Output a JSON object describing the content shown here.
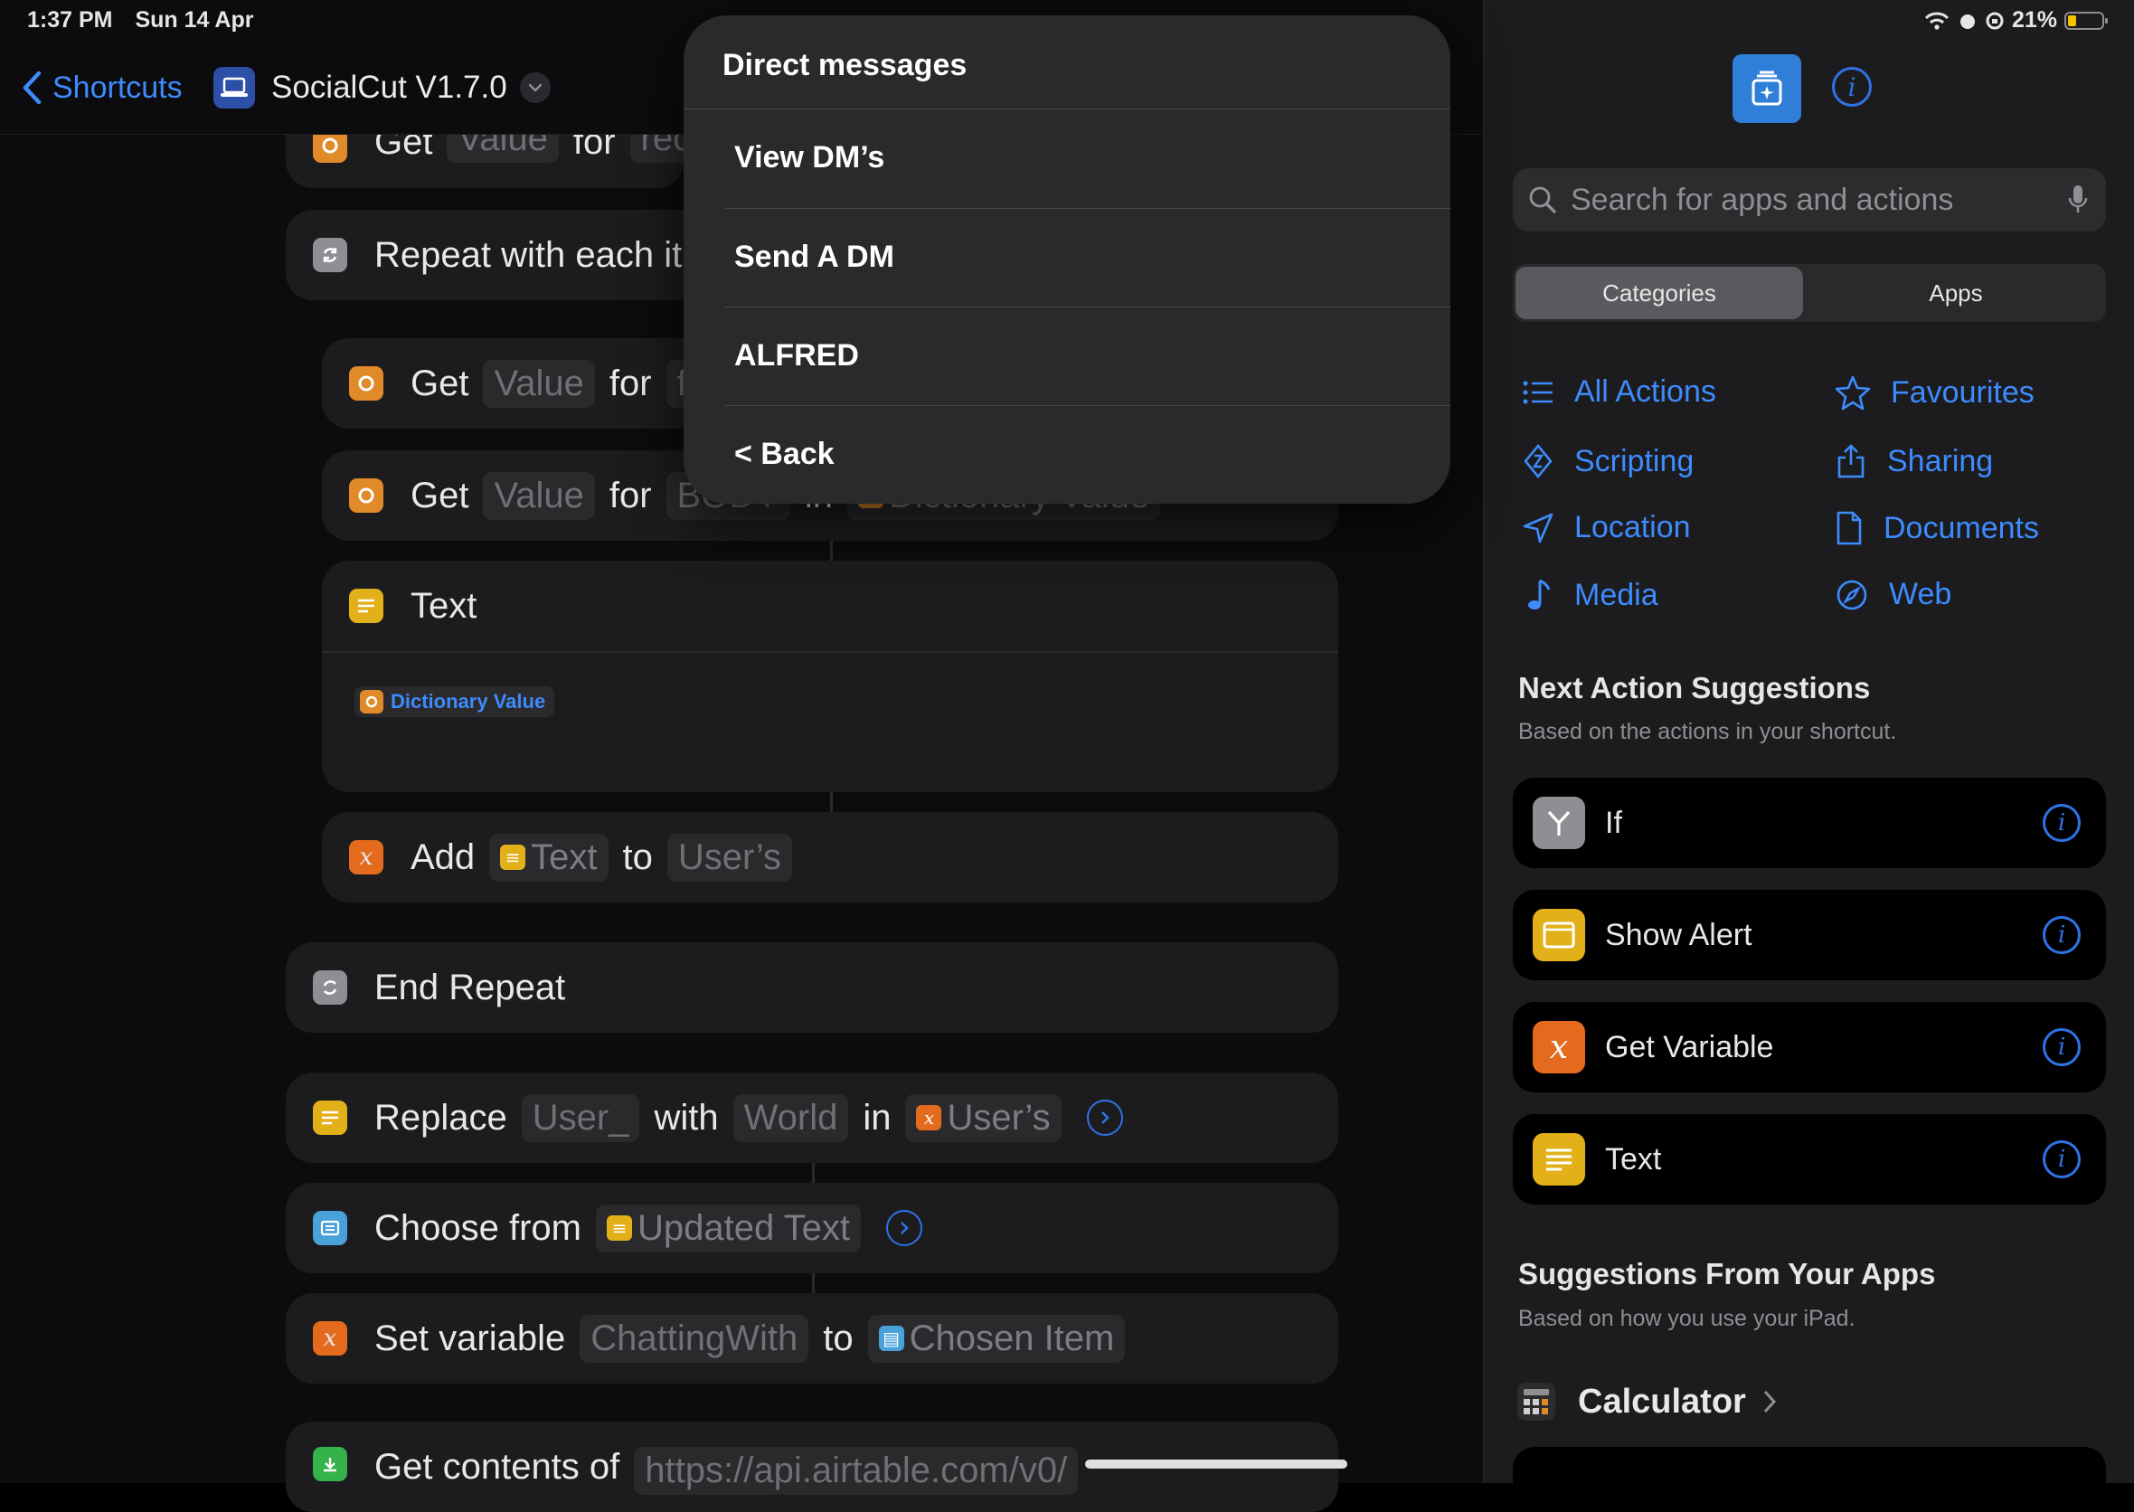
{
  "status_bar": {
    "time": "1:37 PM",
    "date": "Sun 14 Apr",
    "battery": "21%"
  },
  "nav": {
    "back_label": "Shortcuts",
    "title": "SocialCut V1.7.0"
  },
  "actions": {
    "get_top": {
      "verb": "Get",
      "param": "Value",
      "for": "for",
      "key": "rec"
    },
    "repeat": {
      "label": "Repeat with each ite"
    },
    "get1": {
      "verb": "Get",
      "param": "Value",
      "for": "for",
      "key": "f"
    },
    "get2": {
      "verb": "Get",
      "param": "Value",
      "for": "for",
      "key": "BODY",
      "in": "in",
      "var": "Dictionary Value"
    },
    "text": {
      "title": "Text",
      "var": "Dictionary Value"
    },
    "add": {
      "verb": "Add",
      "var": "Text",
      "to": "to",
      "target": "User’s"
    },
    "end_repeat": {
      "label": "End Repeat"
    },
    "replace": {
      "verb": "Replace",
      "find": "User_",
      "with": "with",
      "replacement": "World",
      "in": "in",
      "var": "User’s"
    },
    "choose": {
      "verb": "Choose from",
      "var": "Updated Text"
    },
    "setvar": {
      "verb": "Set variable",
      "name": "ChattingWith",
      "to": "to",
      "var": "Chosen Item"
    },
    "getcontents": {
      "verb": "Get contents of",
      "url": "https://api.airtable.com/v0/"
    }
  },
  "popup": {
    "title": "Direct messages",
    "items": [
      "View DM’s",
      "Send A DM",
      "ALFRED",
      "< Back"
    ]
  },
  "library": {
    "search_placeholder": "Search for apps and actions",
    "segments": [
      "Categories",
      "Apps"
    ],
    "categories": [
      "All Actions",
      "Favourites",
      "Scripting",
      "Sharing",
      "Location",
      "Documents",
      "Media",
      "Web"
    ],
    "next_title": "Next Action Suggestions",
    "next_sub": "Based on the actions in your shortcut.",
    "suggestions": [
      "If",
      "Show Alert",
      "Get Variable",
      "Text"
    ],
    "apps_title": "Suggestions From Your Apps",
    "apps_sub": "Based on how you use your iPad.",
    "app_name": "Calculator"
  },
  "colors": {
    "accent": "#3d8bfd",
    "panel": "#1c1c1e",
    "popup": "#2a2a2c"
  }
}
